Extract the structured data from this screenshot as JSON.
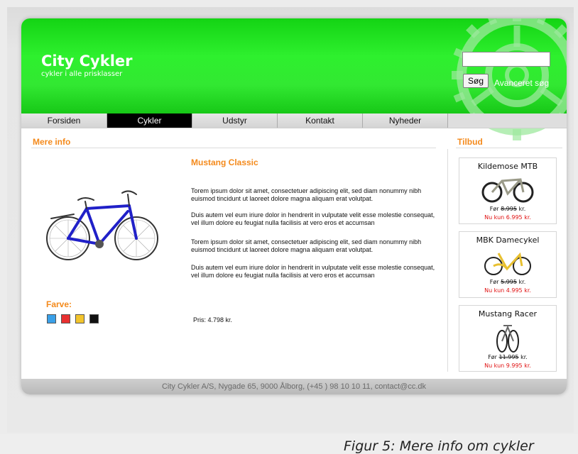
{
  "header": {
    "logo_title": "City Cykler",
    "logo_subtitle": "cykler i alle prisklasser",
    "search_placeholder": "",
    "search_button": "Søg",
    "advanced_search": "Avanceret søg"
  },
  "nav": {
    "items": [
      {
        "label": "Forsiden",
        "active": false
      },
      {
        "label": "Cykler",
        "active": true
      },
      {
        "label": "Udstyr",
        "active": false
      },
      {
        "label": "Kontakt",
        "active": false
      },
      {
        "label": "Nyheder",
        "active": false
      }
    ]
  },
  "main": {
    "section_title": "Mere info",
    "product_name": "Mustang Classic",
    "paragraphs": [
      "Torem ipsum dolor sit amet, consectetuer adipiscing elit, sed diam nonummy nibh euismod tincidunt ut laoreet dolore magna aliquam erat volutpat.",
      "Duis autem vel eum iriure dolor in hendrerit in vulputate velit esse molestie consequat, vel illum dolore eu feugiat nulla facilisis at vero eros et accumsan",
      "Torem ipsum dolor sit amet, consectetuer adipiscing elit, sed diam nonummy nibh euismod tincidunt ut laoreet dolore magna aliquam erat volutpat.",
      "Duis autem vel eum iriure dolor in hendrerit in vulputate velit esse molestie consequat, vel illum dolore eu feugiat nulla facilisis at vero eros et accumsan"
    ],
    "price": "Pris: 4.798 kr.",
    "colour_label": "Farve:",
    "colours": [
      "#3aa0e8",
      "#e83030",
      "#f2c42c",
      "#111111"
    ],
    "bike_color": "#2020c8"
  },
  "sidebar": {
    "title": "Tilbud",
    "offers": [
      {
        "name": "Kildemose MTB",
        "before_label": "Før",
        "before_price": "8.995",
        "before_unit": "kr.",
        "now": "Nu kun 6.995 kr."
      },
      {
        "name": "MBK Damecykel",
        "before_label": "Før",
        "before_price": "5.995",
        "before_unit": "kr.",
        "now": "Nu kun 4.995 kr."
      },
      {
        "name": "Mustang Racer",
        "before_label": "Før",
        "before_price": "11.995",
        "before_unit": "kr.",
        "now": "Nu kun 9.995 kr."
      }
    ]
  },
  "footer": {
    "text": "City Cykler A/S, Nygade 65, 9000 Ålborg, (+45 ) 98 10 10 11, contact@cc.dk"
  },
  "caption": "Figur 5: Mere info om cykler",
  "colors": {
    "brand_green": "#2ee42e",
    "accent_orange": "#f48a1c",
    "sale_red": "#e01010"
  }
}
